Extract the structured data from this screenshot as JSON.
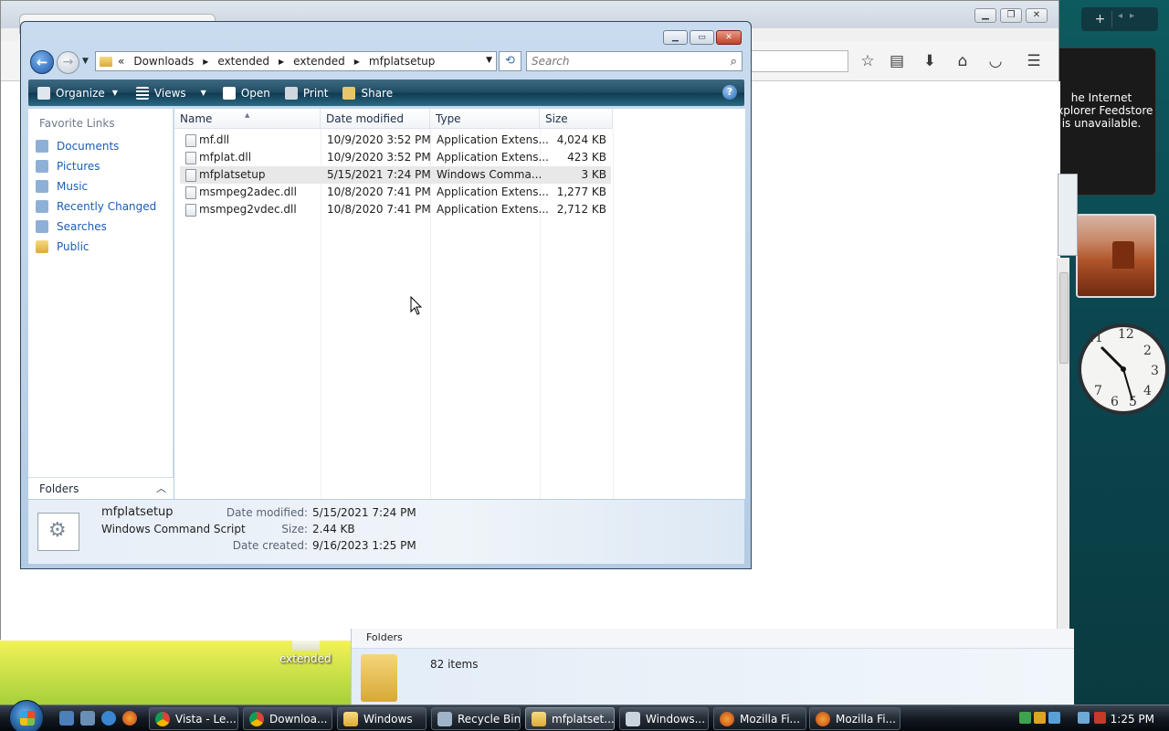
{
  "explorer": {
    "breadcrumb": [
      "Downloads",
      "extended",
      "extended",
      "mfplatsetup"
    ],
    "breadcrumb_prefix": "«",
    "search_placeholder": "Search",
    "commands": {
      "organize": "Organize",
      "views": "Views",
      "open": "Open",
      "print": "Print",
      "share": "Share"
    },
    "favorite_links_title": "Favorite Links",
    "favorite_links": [
      {
        "label": "Documents",
        "icon": "documents-icon"
      },
      {
        "label": "Pictures",
        "icon": "pictures-icon"
      },
      {
        "label": "Music",
        "icon": "music-icon"
      },
      {
        "label": "Recently Changed",
        "icon": "recent-icon"
      },
      {
        "label": "Searches",
        "icon": "searches-icon"
      },
      {
        "label": "Public",
        "icon": "folder-icon"
      }
    ],
    "folders_label": "Folders",
    "columns": {
      "name": "Name",
      "date": "Date modified",
      "type": "Type",
      "size": "Size"
    },
    "files": [
      {
        "name": "mf.dll",
        "date": "10/9/2020 3:52 PM",
        "type": "Application Extens...",
        "size": "4,024 KB"
      },
      {
        "name": "mfplat.dll",
        "date": "10/9/2020 3:52 PM",
        "type": "Application Extens...",
        "size": "423 KB"
      },
      {
        "name": "mfplatsetup",
        "date": "5/15/2021 7:24 PM",
        "type": "Windows Comma...",
        "size": "3 KB"
      },
      {
        "name": "msmpeg2adec.dll",
        "date": "10/8/2020 7:41 PM",
        "type": "Application Extens...",
        "size": "1,277 KB"
      },
      {
        "name": "msmpeg2vdec.dll",
        "date": "10/8/2020 7:41 PM",
        "type": "Application Extens...",
        "size": "2,712 KB"
      }
    ],
    "details": {
      "name": "mfplatsetup",
      "kind": "Windows Command Script",
      "modified_label": "Date modified:",
      "modified": "5/15/2021 7:24 PM",
      "size_label": "Size:",
      "size": "2.44 KB",
      "created_label": "Date created:",
      "created": "9/16/2023 1:25 PM"
    }
  },
  "background_explorer": {
    "folders_label": "Folders",
    "item_count": "82 items"
  },
  "desktop": {
    "icon_label": "extended"
  },
  "gadgets": {
    "feed_message": "he Internet Explorer Feedstore is unavailable."
  },
  "taskbar": {
    "buttons": [
      {
        "label": "Vista - Le...",
        "icon": "chrome-icon"
      },
      {
        "label": "Downloa...",
        "icon": "chrome-icon"
      },
      {
        "label": "Windows",
        "icon": "folder-icon"
      },
      {
        "label": "Recycle Bin",
        "icon": "recycle-bin-icon"
      },
      {
        "label": "mfplatset...",
        "icon": "folder-icon"
      },
      {
        "label": "Windows...",
        "icon": "window-icon"
      },
      {
        "label": "Mozilla Fi...",
        "icon": "firefox-icon"
      },
      {
        "label": "Mozilla Fi...",
        "icon": "firefox-icon"
      }
    ],
    "time": "1:25 PM"
  }
}
